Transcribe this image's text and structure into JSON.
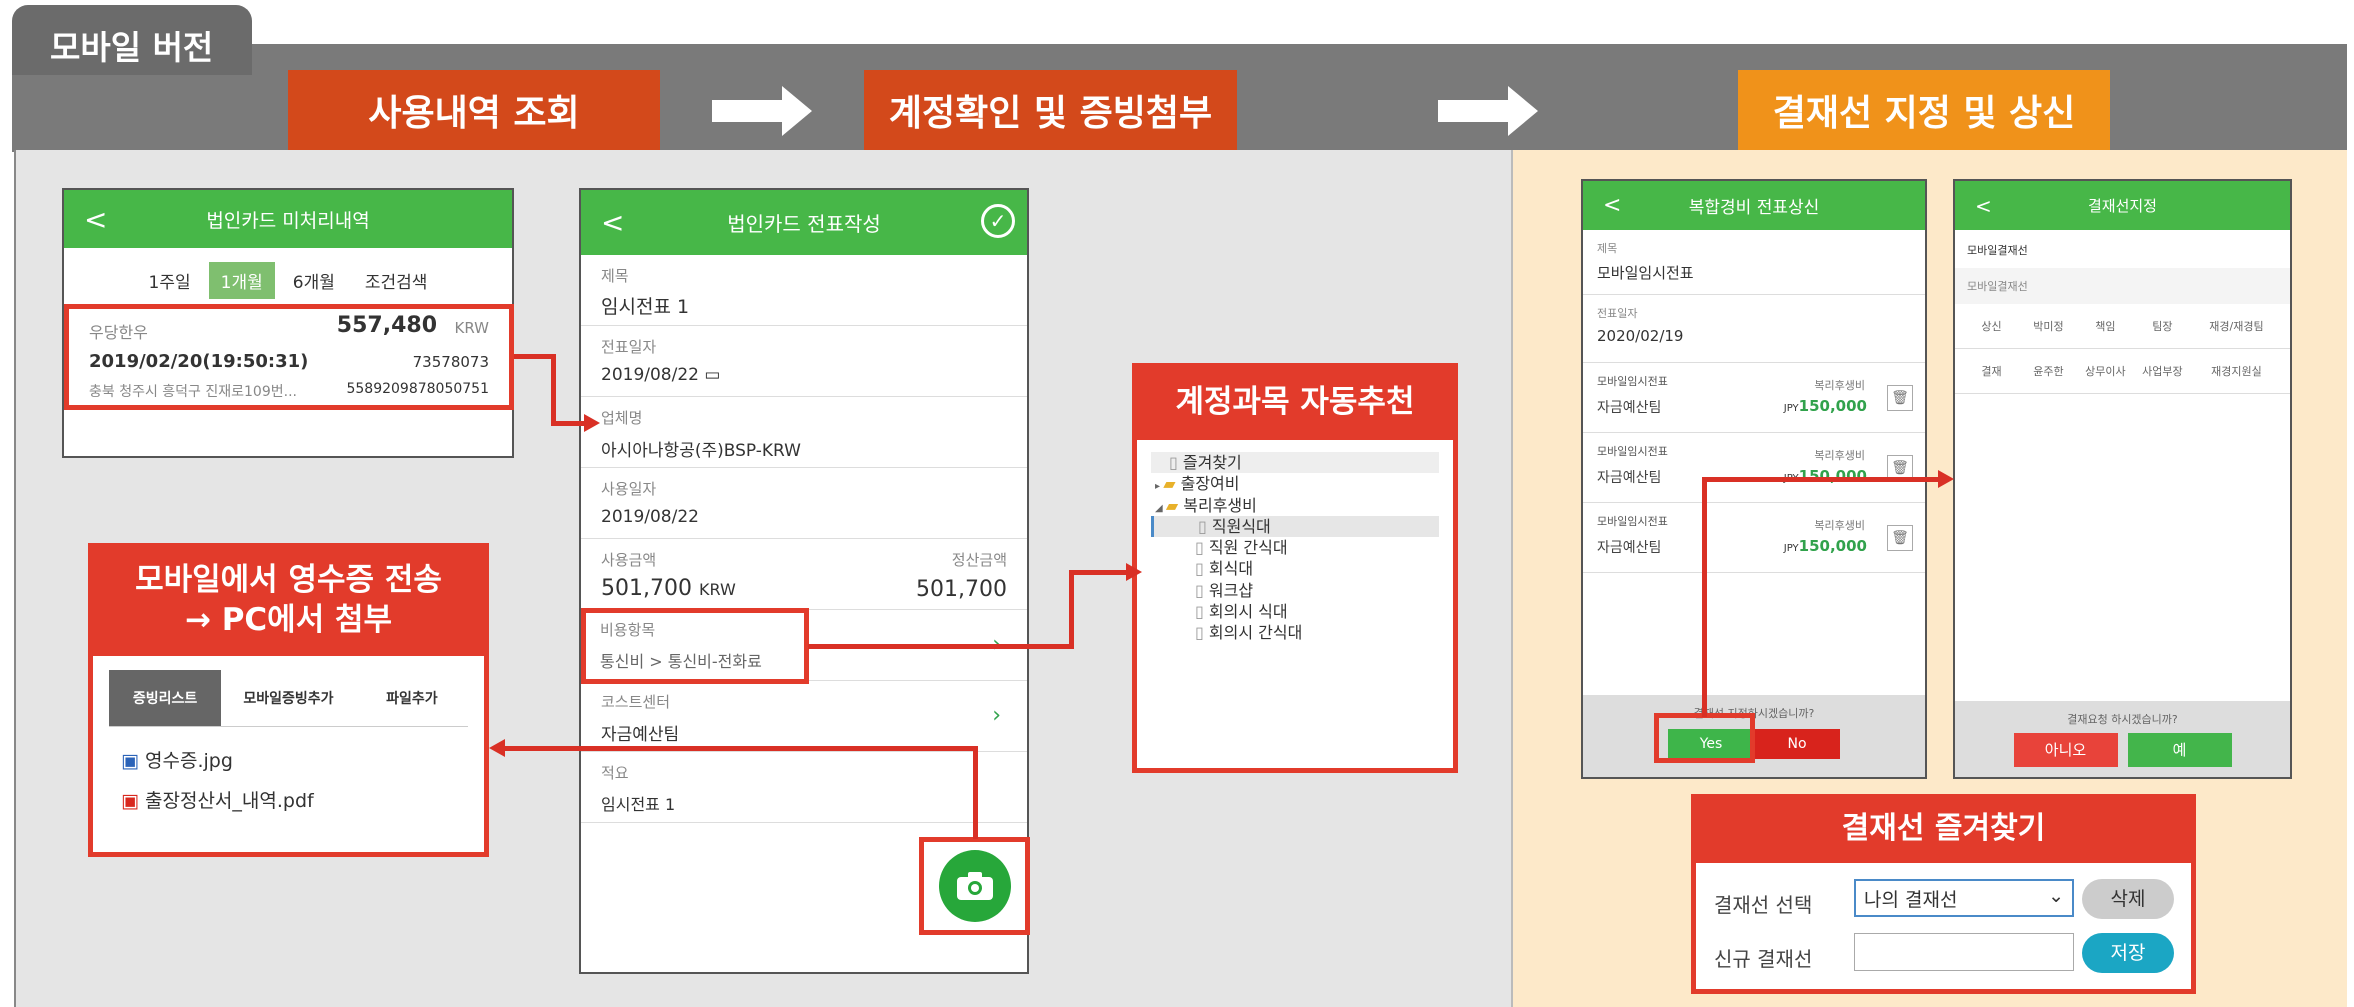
{
  "header": {
    "title": "모바일 버전"
  },
  "steps": [
    "사용내역 조회",
    "계정확인 및 증빙첨부",
    "결재선 지정 및 상신"
  ],
  "card_list": {
    "title": "법인카드 미처리내역",
    "tabs": [
      "1주일",
      "1개월",
      "6개월",
      "조건검색"
    ],
    "active_tab": "1개월",
    "item": {
      "merchant": "우당한우",
      "amount": "557,480",
      "currency": "KRW",
      "datetime": "2019/02/20(19:50:31)",
      "approval_no": "73578073",
      "address": "충북 청주시 흥덕구 진재로109번...",
      "card_no": "5589209878050751"
    }
  },
  "receipt": {
    "title_line1": "모바일에서 영수증 전송",
    "title_line2": "→ PC에서 첨부",
    "tabs": [
      "증빙리스트",
      "모바일증빙추가",
      "파일추가"
    ],
    "files": [
      "영수증.jpg",
      "출장정산서_내역.pdf"
    ]
  },
  "form": {
    "title": "법인카드 전표작성",
    "fields": [
      {
        "label": "제목",
        "value": "임시전표 1"
      },
      {
        "label": "전표일자",
        "value": "2019/08/22"
      },
      {
        "label": "업체명",
        "value": "아시아나항공(주)BSP-KRW"
      },
      {
        "label": "사용일자",
        "value": "2019/08/22"
      }
    ],
    "amount": {
      "label": "사용금액",
      "value": "501,700",
      "currency": "KRW",
      "settle_label": "정산금액",
      "settle_value": "501,700"
    },
    "expense": {
      "label": "비용항목",
      "value": "통신비 > 통신비-전화료"
    },
    "cost_center": {
      "label": "코스트센터",
      "value": "자금예산팀"
    },
    "summary": {
      "label": "적요",
      "value": "임시전표 1"
    }
  },
  "account": {
    "title": "계정과목 자동추천",
    "tree": [
      {
        "text": "즐겨찾기",
        "type": "file",
        "level": 0
      },
      {
        "text": "출장여비",
        "type": "folder",
        "level": 0,
        "arrow": "▸"
      },
      {
        "text": "복리후생비",
        "type": "folder",
        "level": 0,
        "arrow": "◢"
      },
      {
        "text": "직원식대",
        "type": "file",
        "level": 1
      },
      {
        "text": "직원 간식대",
        "type": "file",
        "level": 1
      },
      {
        "text": "회식대",
        "type": "file",
        "level": 1
      },
      {
        "text": "워크샵",
        "type": "file",
        "level": 1
      },
      {
        "text": "회의시 식대",
        "type": "file",
        "level": 1
      },
      {
        "text": "회의시 간식대",
        "type": "file",
        "level": 1
      }
    ]
  },
  "submit": {
    "title": "복합경비 전표상신",
    "subject_label": "제목",
    "subject": "모바일임시전표",
    "date_label": "전표일자",
    "date": "2020/02/19",
    "items": [
      {
        "title": "모바일임시전표",
        "dept": "자금예산팀",
        "account": "복리후생비",
        "cur": "JPY",
        "amount": "150,000"
      },
      {
        "title": "모바일임시전표",
        "dept": "자금예산팀",
        "account": "복리후생비",
        "cur": "JPY",
        "amount": "150,000"
      },
      {
        "title": "모바일임시전표",
        "dept": "자금예산팀",
        "account": "복리후생비",
        "cur": "JPY",
        "amount": "150,000"
      }
    ],
    "confirm": "결재선 지정하시겠습니까?",
    "yes": "Yes",
    "no": "No"
  },
  "approval": {
    "title": "결재선지정",
    "section1": "모바일결재선",
    "section2": "모바일결재선",
    "row1": [
      "상신",
      "박미정",
      "책임",
      "팀장",
      "재경/재경팀"
    ],
    "row2": [
      "결재",
      "윤주한",
      "상무이사",
      "사업부장",
      "재경지원실"
    ],
    "confirm": "결재요청 하시겠습니까?",
    "no": "아니오",
    "yes": "예"
  },
  "favorites": {
    "title": "결재선 즐겨찾기",
    "select_label": "결재선 선택",
    "select_value": "나의 결재선",
    "delete": "삭제",
    "new_label": "신규 결재선",
    "new_value": "",
    "save": "저장"
  }
}
